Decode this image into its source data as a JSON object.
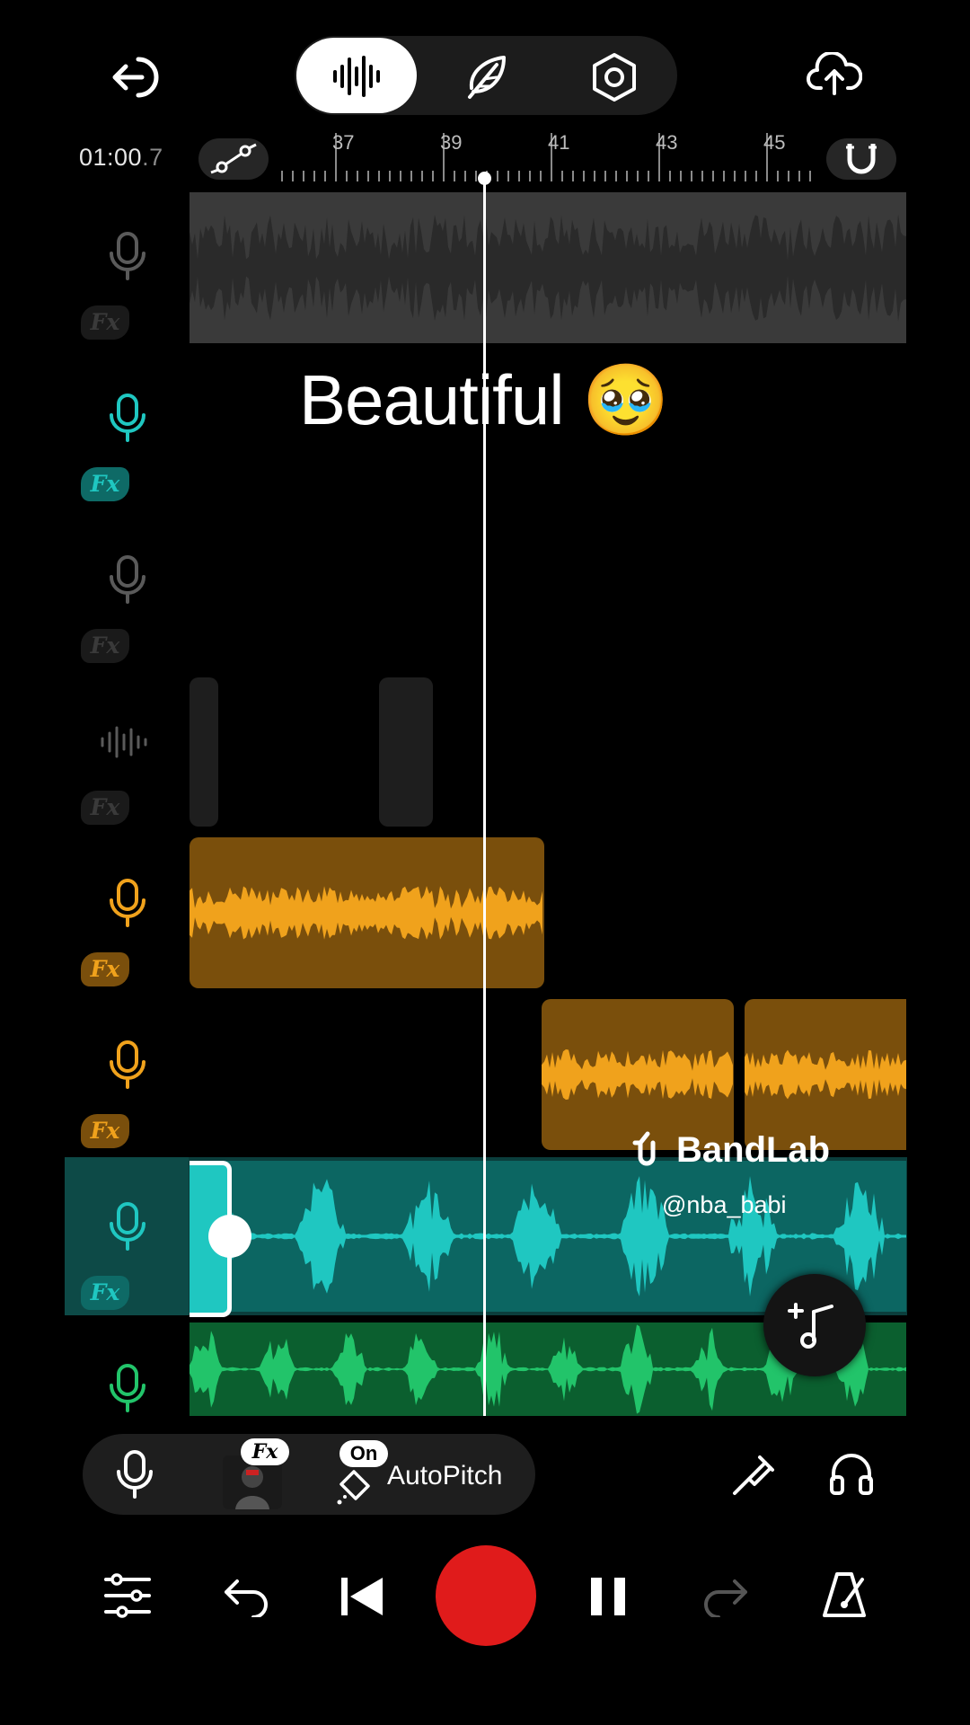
{
  "toolbar": {
    "tabs": [
      {
        "name": "waveform",
        "active": true
      },
      {
        "name": "feather",
        "active": false
      },
      {
        "name": "settings",
        "active": false
      }
    ]
  },
  "timeline": {
    "time_main": "01:00",
    "time_frac": ".7",
    "markers": [
      "37",
      "39",
      "41",
      "43",
      "45"
    ]
  },
  "overlay": {
    "lyric": "Beautiful 🥹",
    "brand": "BandLab",
    "handle": "@nba_babi"
  },
  "tracks": [
    {
      "icon": "mic-icon",
      "fx": "Fx",
      "color": "#5a5a5a",
      "state": "muted"
    },
    {
      "icon": "mic-icon",
      "fx": "Fx",
      "color": "#1fc7c1",
      "state": "active"
    },
    {
      "icon": "mic-icon",
      "fx": "Fx",
      "color": "#5a5a5a",
      "state": "muted"
    },
    {
      "icon": "waveform-icon",
      "fx": "Fx",
      "color": "#5a5a5a",
      "state": "muted"
    },
    {
      "icon": "mic-icon",
      "fx": "Fx",
      "color": "#f0a21c",
      "state": "active"
    },
    {
      "icon": "mic-icon",
      "fx": "Fx",
      "color": "#f0a21c",
      "state": "active"
    },
    {
      "icon": "mic-icon",
      "fx": "Fx",
      "color": "#1fc7c1",
      "state": "selected"
    },
    {
      "icon": "mic-icon",
      "fx": "",
      "color": "#22c46a",
      "state": "active"
    }
  ],
  "effects_bar": {
    "fx_label": "Fx",
    "on_label": "On",
    "autopitch_label": "AutoPitch"
  },
  "colors": {
    "teal": "#1fc7c1",
    "teal_clip": "#0c6662",
    "orange": "#f0a21c",
    "orange_clip": "#7a4f0c",
    "green": "#22c46a",
    "green_clip": "#0b5f2f",
    "record": "#e01b1b"
  }
}
